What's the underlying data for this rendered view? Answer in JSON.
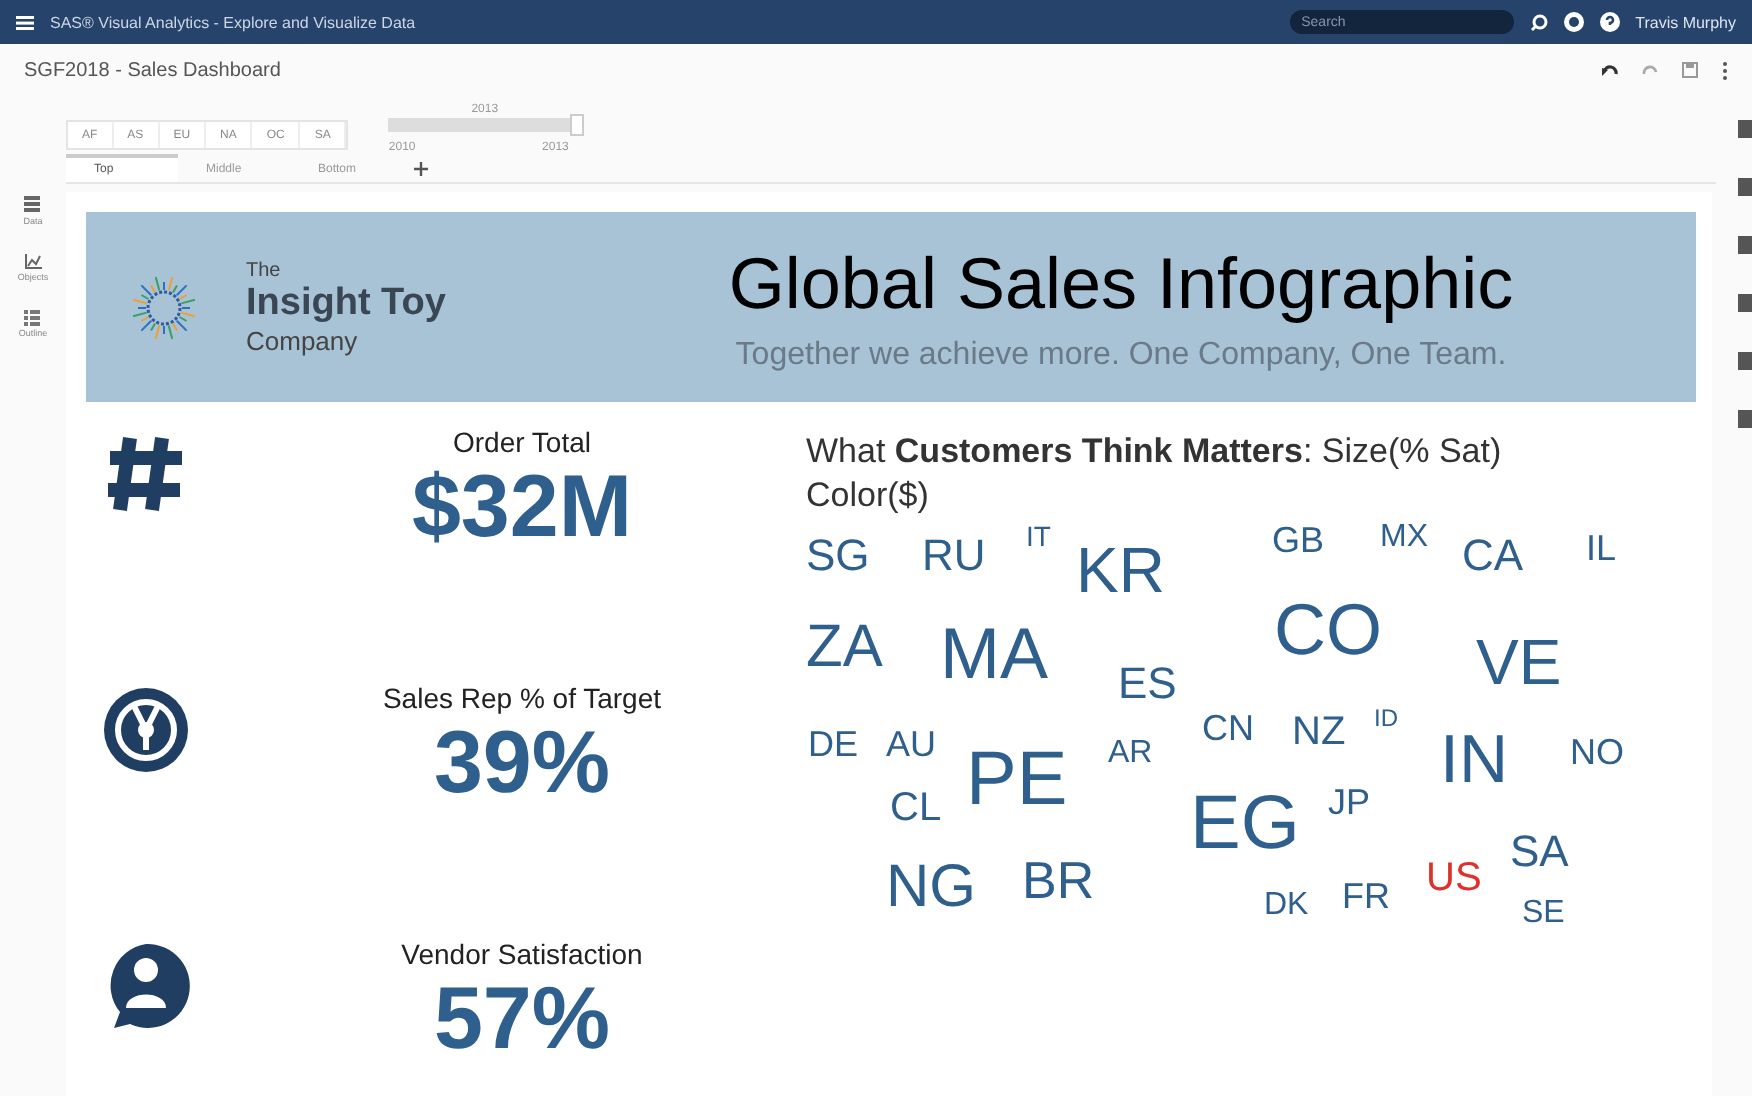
{
  "topbar": {
    "app_title": "SAS® Visual Analytics - Explore and Visualize Data",
    "search": {
      "placeholder": "Search"
    },
    "user": "Travis Murphy"
  },
  "report": {
    "title": "SGF2018 - Sales Dashboard"
  },
  "left_panel": [
    {
      "label": "Data",
      "kind": "data"
    },
    {
      "label": "Objects",
      "kind": "objects"
    },
    {
      "label": "Outline",
      "kind": "outline"
    }
  ],
  "region_filter": [
    {
      "label": "AF",
      "selected": false
    },
    {
      "label": "AS",
      "selected": false
    },
    {
      "label": "EU",
      "selected": false
    },
    {
      "label": "NA",
      "selected": false
    },
    {
      "label": "OC",
      "selected": false
    },
    {
      "label": "SA",
      "selected": false
    }
  ],
  "year_slider": {
    "value": "2013",
    "min": "2010",
    "max": "2013",
    "level": 1
  },
  "page_tabs": [
    {
      "label": "Top",
      "selected": true
    },
    {
      "label": "Middle",
      "selected": false
    },
    {
      "label": "Bottom",
      "selected": false
    }
  ],
  "banner": {
    "company_small": "The",
    "company_name": "Insight Toy",
    "company_sub": "Company",
    "title": "Global Sales Infographic",
    "tagline": "Together we achieve more. One Company, One Team."
  },
  "kpis": [
    {
      "kind": "hash",
      "label": "Order Total",
      "value": "$32M"
    },
    {
      "kind": "gauge",
      "label": "Sales Rep % of Target",
      "value": "39%"
    },
    {
      "kind": "person",
      "label": "Vendor Satisfaction",
      "value": "57%"
    }
  ],
  "word_cloud": {
    "title": "What **Customers Think Matters**: Size(% Sat) Color($)",
    "words": [
      {
        "text": "SG",
        "color": "#2f5f8c"
      },
      {
        "text": "RU",
        "color": "#2f5f8c"
      },
      {
        "text": "IT",
        "color": "#2f5f8c"
      },
      {
        "text": "KR",
        "color": "#2f5f8c"
      },
      {
        "text": "GB",
        "color": "#2f5f8c"
      },
      {
        "text": "MX",
        "color": "#2f5f8c"
      },
      {
        "text": "CA",
        "color": "#2f5f8c"
      },
      {
        "text": "IL",
        "color": "#2f5f8c"
      },
      {
        "text": "ZA",
        "color": "#2f5f8c"
      },
      {
        "text": "MA",
        "color": "#2f5f8c"
      },
      {
        "text": "ES",
        "color": "#2f5f8c"
      },
      {
        "text": "CO",
        "color": "#2f5f8c"
      },
      {
        "text": "VE",
        "color": "#2f5f8c"
      },
      {
        "text": "DE",
        "color": "#2f5f8c"
      },
      {
        "text": "AU",
        "color": "#2f5f8c"
      },
      {
        "text": "AR",
        "color": "#2f5f8c"
      },
      {
        "text": "CN",
        "color": "#2f5f8c"
      },
      {
        "text": "NZ",
        "color": "#2f5f8c"
      },
      {
        "text": "ID",
        "color": "#2f5f8c"
      },
      {
        "text": "IN",
        "color": "#2f5f8c"
      },
      {
        "text": "NO",
        "color": "#2f5f8c"
      },
      {
        "text": "PE",
        "color": "#2f5f8c"
      },
      {
        "text": "CL",
        "color": "#2f5f8c"
      },
      {
        "text": "EG",
        "color": "#2f5f8c"
      },
      {
        "text": "JP",
        "color": "#2f5f8c"
      },
      {
        "text": "SA",
        "color": "#2f5f8c"
      },
      {
        "text": "NG",
        "color": "#2f5f8c"
      },
      {
        "text": "BR",
        "color": "#2f5f8c"
      },
      {
        "text": "DK",
        "color": "#2f5f8c"
      },
      {
        "text": "FR",
        "color": "#2f5f8c"
      },
      {
        "text": "US",
        "color": "#e0302c"
      },
      {
        "text": "SE",
        "color": "#2f5f8c"
      }
    ]
  }
}
